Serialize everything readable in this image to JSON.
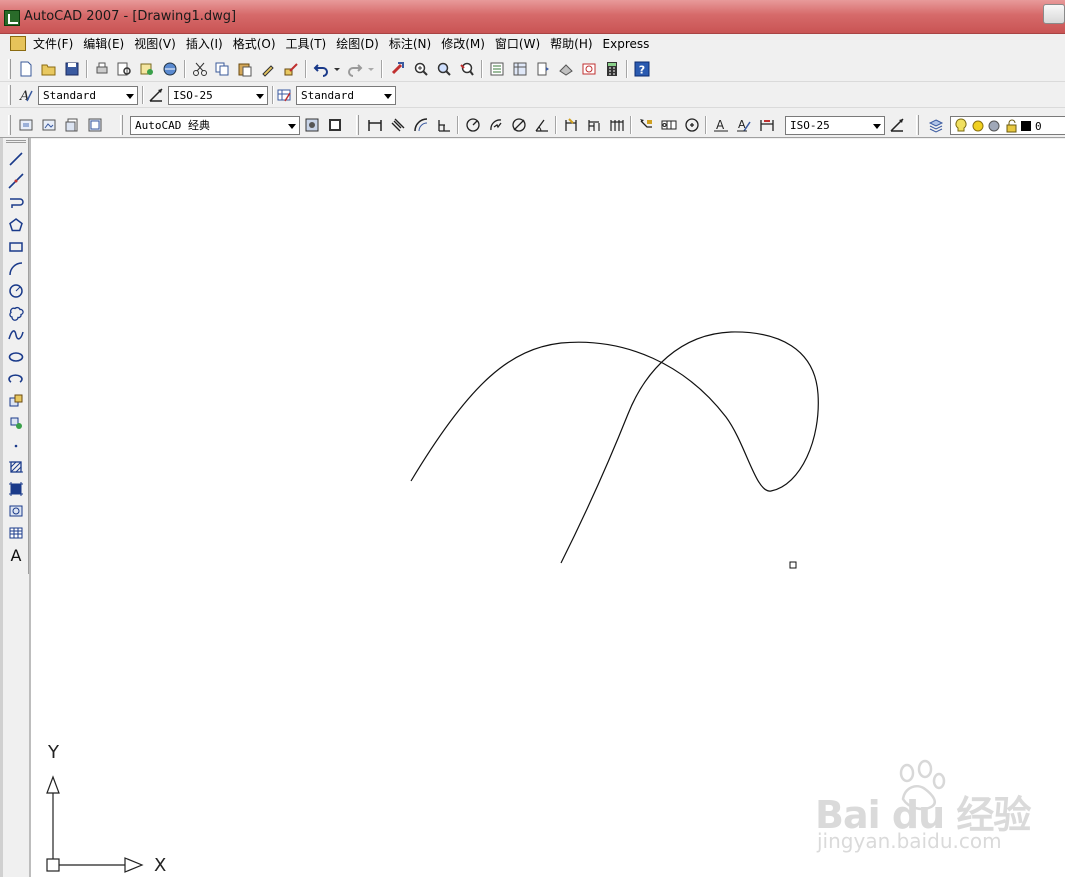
{
  "window": {
    "title": "AutoCAD 2007 - [Drawing1.dwg]"
  },
  "menu": {
    "items": [
      "文件(F)",
      "编辑(E)",
      "视图(V)",
      "插入(I)",
      "格式(O)",
      "工具(T)",
      "绘图(D)",
      "标注(N)",
      "修改(M)",
      "窗口(W)",
      "帮助(H)",
      "Express"
    ]
  },
  "styles_toolbar": {
    "text_style": "Standard",
    "dim_style": "ISO-25",
    "table_style": "Standard"
  },
  "workspace_toolbar": {
    "workspace": "AutoCAD 经典",
    "dim_style_current": "ISO-25",
    "layer_value": "0"
  },
  "ucs": {
    "x_label": "X",
    "y_label": "Y"
  },
  "watermark": {
    "brand": "Bai du 经验",
    "url": "jingyan.baidu.com"
  },
  "colors": {
    "title_bar": "#d66a6a",
    "canvas": "#ffffff",
    "ui_gray": "#f0f0f0"
  }
}
